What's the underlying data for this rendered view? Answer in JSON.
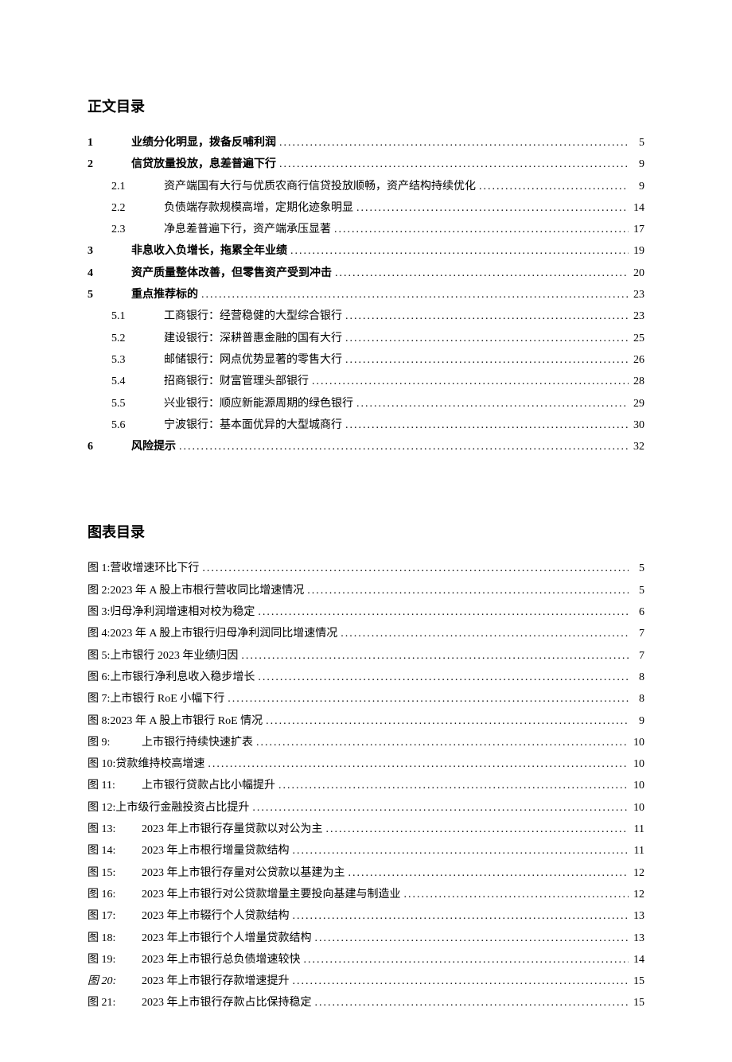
{
  "headings": {
    "main_toc": "正文目录",
    "figure_toc": "图表目录"
  },
  "toc": [
    {
      "level": 1,
      "num": "1",
      "text": "业绩分化明显，拨备反哺利润",
      "page": "5"
    },
    {
      "level": 1,
      "num": "2",
      "text": "信贷放量投放，息差普遍下行",
      "page": "9"
    },
    {
      "level": 2,
      "num": "2.1",
      "text": "资产端国有大行与优质农商行信贷投放顺畅，资产结构持续优化",
      "page": "9"
    },
    {
      "level": 2,
      "num": "2.2",
      "text": "负债端存款规模高增，定期化迹象明显",
      "page": "14"
    },
    {
      "level": 2,
      "num": "2.3",
      "text": "净息差普遍下行，资产端承压显著",
      "page": "17"
    },
    {
      "level": 1,
      "num": "3",
      "text": "非息收入负增长，拖累全年业绩",
      "page": "19"
    },
    {
      "level": 1,
      "num": "4",
      "text": "资产质量整体改善，但零售资产受到冲击",
      "page": "20"
    },
    {
      "level": 1,
      "num": "5",
      "text": "重点推荐标的",
      "page": "23"
    },
    {
      "level": 2,
      "num": "5.1",
      "text": "工商银行：经营稳健的大型综合银行",
      "page": "23"
    },
    {
      "level": 2,
      "num": "5.2",
      "text": "建设银行：深耕普惠金融的国有大行",
      "page": "25"
    },
    {
      "level": 2,
      "num": "5.3",
      "text": "邮储银行：网点优势显著的零售大行",
      "page": "26"
    },
    {
      "level": 2,
      "num": "5.4",
      "text": "招商银行：财富管理头部银行",
      "page": "28"
    },
    {
      "level": 2,
      "num": "5.5",
      "text": "兴业银行：顺应新能源周期的绿色银行",
      "page": "29"
    },
    {
      "level": 2,
      "num": "5.6",
      "text": "宁波银行：基本面优异的大型城商行",
      "page": "30"
    },
    {
      "level": 1,
      "num": "6",
      "text": "风险提示",
      "page": "32"
    }
  ],
  "figures": [
    {
      "label": "图 1:",
      "text": "营收增速环比下行",
      "page": "5",
      "inline": true
    },
    {
      "label": "图 2:",
      "text": "2023 年 A 股上市根行营收同比增速情况",
      "page": "5",
      "inline": true
    },
    {
      "label": "图 3:",
      "text": "归母净利润增速相对校为稳定",
      "page": "6",
      "inline": true
    },
    {
      "label": "图 4:",
      "text": "2023 年 A 股上市银行归母净利润同比增速情况",
      "page": "7",
      "inline": true
    },
    {
      "label": "图 5:",
      "text": "上市银行 2023 年业绩归因",
      "page": "7",
      "inline": true
    },
    {
      "label": "图 6:",
      "text": "上市银行净利息收入稳步增长",
      "page": "8",
      "inline": true
    },
    {
      "label": "图 7:",
      "text": "上市银行 RoE 小幅下行",
      "page": "8",
      "inline": true
    },
    {
      "label": "图 8:",
      "text": "2023 年 A 股上市银行 RoE 情况",
      "page": "9",
      "inline": true
    },
    {
      "label": "图 9:",
      "text": " 上市银行持续快速扩表",
      "page": "10",
      "inline": false
    },
    {
      "label": "图 10:",
      "text": "贷款维持校高增速",
      "page": "10",
      "inline": true
    },
    {
      "label": "图 11:",
      "text": " 上市银行贷款占比小幅提升",
      "page": "10",
      "inline": false
    },
    {
      "label": "图 12:",
      "text": "上市级行金融投资占比提升",
      "page": "10",
      "inline": true
    },
    {
      "label": "图 13:",
      "text": "2023 年上市银行存量贷款以对公为主",
      "page": "11",
      "inline": false
    },
    {
      "label": "图 14:",
      "text": "2023 年上市根行增量贷款结构",
      "page": "11",
      "inline": false
    },
    {
      "label": "图 15:",
      "text": "2023 年上市银行存量对公贷款以基建为主",
      "page": "12",
      "inline": false
    },
    {
      "label": "图 16:",
      "text": "2023 年上市银行对公贷款增量主要投向基建与制造业",
      "page": "12",
      "inline": false
    },
    {
      "label": "图 17:",
      "text": "2023 年上市辍行个人贷款结构",
      "page": "13",
      "inline": false
    },
    {
      "label": "图 18:",
      "text": "2023 年上市银行个人增量贷款结构",
      "page": "13",
      "inline": false
    },
    {
      "label": "图 19:",
      "text": "2023 年上市银行总负债增速较快",
      "page": "14",
      "inline": false
    },
    {
      "label": "图 20:",
      "text": "2023 年上市银行存款增速提升",
      "page": "15",
      "inline": false,
      "italic_label": true
    },
    {
      "label": "图 21:",
      "text": "2023 年上市银行存款占比保持稳定",
      "page": "15",
      "inline": false
    }
  ]
}
